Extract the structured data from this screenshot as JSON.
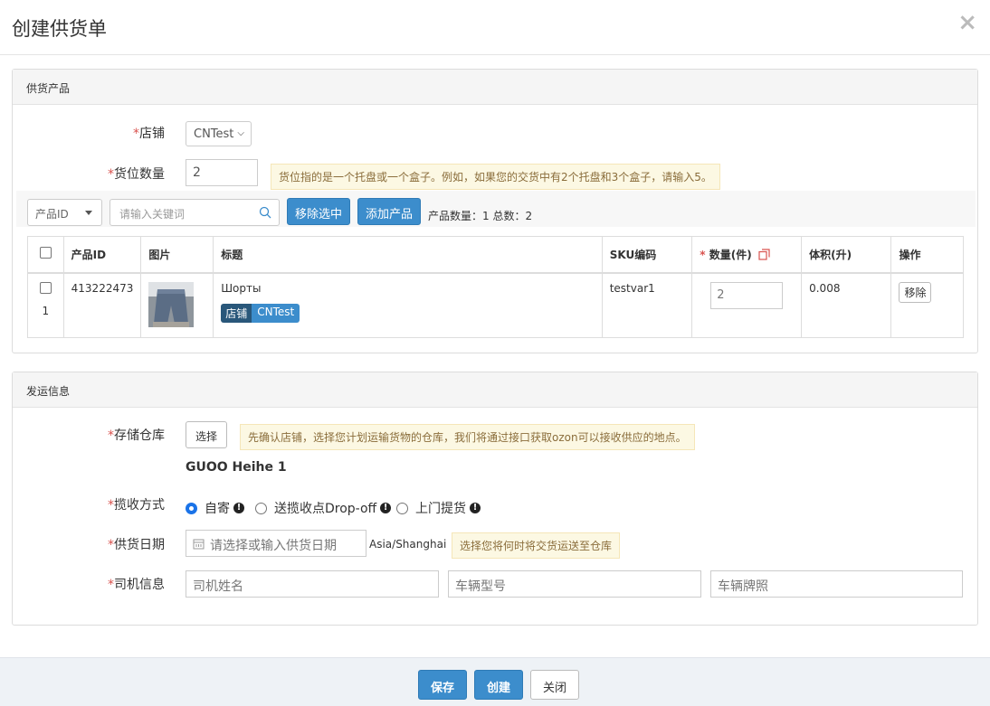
{
  "modal": {
    "title": "创建供货单",
    "close_glyph": "×"
  },
  "supply_products": {
    "heading": "供货产品",
    "shop_label": "店铺",
    "shop_value": "CNTest",
    "slots_label": "货位数量",
    "slots_value": "2",
    "slots_tip": "货位指的是一个托盘或一个盒子。例如，如果您的交货中有2个托盘和3个盒子，请输入5。",
    "filter_type": "产品ID",
    "keyword_placeholder": "请输入关键词",
    "remove_selected_label": "移除选中",
    "add_product_label": "添加产品",
    "count_text": "产品数量：1  总数：2",
    "table": {
      "headers": {
        "product_id": "产品ID",
        "image": "图片",
        "title": "标题",
        "sku": "SKU编码",
        "qty": "数量(件)",
        "volume": "体积(升)",
        "action": "操作"
      },
      "rows": [
        {
          "index": "1",
          "product_id": "413222473",
          "title": "Шорты",
          "shop_badge_label": "店铺",
          "shop_badge_value": "CNTest",
          "sku": "testvar1",
          "qty": "2",
          "volume": "0.008",
          "remove_label": "移除"
        }
      ]
    }
  },
  "shipping": {
    "heading": "发运信息",
    "warehouse_label": "存储仓库",
    "choose_label": "选择",
    "warehouse_tip": "先确认店铺，选择您计划运输货物的仓库，我们将通过接口获取ozon可以接收供应的地点。",
    "warehouse_name": "GUOO Heihe 1",
    "method_label": "揽收方式",
    "methods": [
      "自寄",
      "送揽收点Drop-off",
      "上门提货"
    ],
    "method_selected": "自寄",
    "date_label": "供货日期",
    "date_placeholder": "请选择或输入供货日期",
    "timezone": "Asia/Shanghai",
    "date_tip": "选择您将何时将交货运送至仓库",
    "driver_label": "司机信息",
    "driver_name_placeholder": "司机姓名",
    "vehicle_model_placeholder": "车辆型号",
    "vehicle_plate_placeholder": "车辆牌照"
  },
  "footer": {
    "save_label": "保存",
    "create_label": "创建",
    "close_label": "关闭"
  },
  "colors": {
    "primary": "#3c8dcc",
    "required": "#d9534f",
    "tip_bg": "#fcf8e3"
  }
}
